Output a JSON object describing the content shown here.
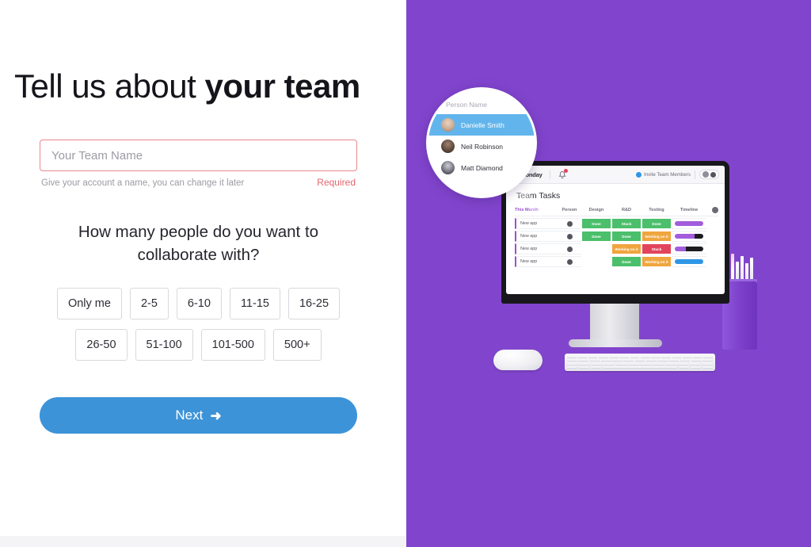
{
  "left": {
    "headline": {
      "light": "Tell us about ",
      "bold": "your team"
    },
    "team_field": {
      "placeholder": "Your Team Name",
      "value": "",
      "hint": "Give your account a name, you can change it later",
      "required_label": "Required",
      "border_color": "#e9888c",
      "required_color": "#e2666f"
    },
    "question": "How many people do you want to collaborate with?",
    "options_row1": [
      "Only me",
      "2-5",
      "6-10",
      "11-15",
      "16-25"
    ],
    "options_row2": [
      "26-50",
      "51-100",
      "101-500",
      "500+"
    ],
    "next_button": {
      "label": "Next",
      "arrow": "➜",
      "color": "#3d93d8"
    }
  },
  "right": {
    "background_color": "#8145cd",
    "monitor": {
      "topbar": {
        "logo_text": "monday",
        "invite_label": "Invite Team Members"
      },
      "board_title": "Team Tasks",
      "columns": [
        "This Month",
        "Person",
        "Design",
        "R&D",
        "Testing",
        "Timeline"
      ],
      "rows": [
        {
          "name": "New app",
          "design": {
            "label": "Done",
            "color": "#4BBF6B"
          },
          "rnd": {
            "label": "Stuck",
            "color": "#4BBF6B"
          },
          "testing": {
            "label": "Done",
            "color": "#4BBF6B"
          },
          "timeline": {
            "fill": "#A25DDC",
            "rest": "#A25DDC",
            "pct": 100
          }
        },
        {
          "name": "New app",
          "design": {
            "label": "Done",
            "color": "#4BBF6B"
          },
          "rnd": {
            "label": "Done",
            "color": "#4BBF6B"
          },
          "testing": {
            "label": "Working on it",
            "color": "#F0A53E"
          },
          "timeline": {
            "fill": "#A25DDC",
            "rest": "#1b1b20",
            "pct": 70
          }
        },
        {
          "name": "New app",
          "design": {
            "label": "",
            "color": "#ffffff"
          },
          "rnd": {
            "label": "Working on it",
            "color": "#F0A53E"
          },
          "testing": {
            "label": "Stuck",
            "color": "#E2445C"
          },
          "timeline": {
            "fill": "#A25DDC",
            "rest": "#1b1b20",
            "pct": 40
          }
        },
        {
          "name": "New app",
          "design": {
            "label": "",
            "color": "#ffffff"
          },
          "rnd": {
            "label": "Done",
            "color": "#4BBF6B"
          },
          "testing": {
            "label": "Working on it",
            "color": "#F0A53E"
          },
          "timeline": {
            "fill": "#2E96E6",
            "rest": "#2E96E6",
            "pct": 100
          }
        }
      ]
    },
    "magnifier": {
      "search_placeholder": "Person Name",
      "people": [
        {
          "name": "Danielle Smith",
          "selected": true
        },
        {
          "name": "Neil Robinson",
          "selected": false
        },
        {
          "name": "Matt Diamond",
          "selected": false
        }
      ]
    }
  }
}
